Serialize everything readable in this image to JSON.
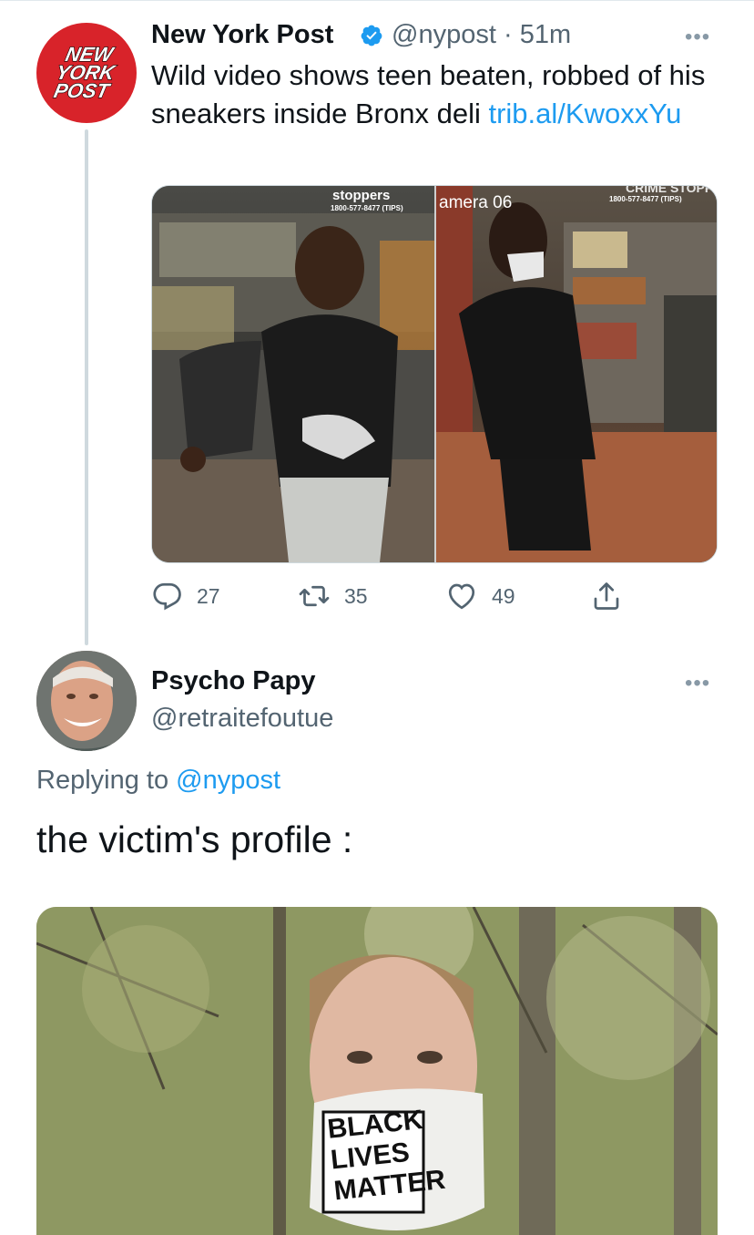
{
  "tweet": {
    "author_name": "New York Post",
    "author_handle": "@nypost",
    "separator": "·",
    "time": "51m",
    "more_label": "•••",
    "avatar_logo": [
      "NEW",
      "YORK",
      "POST"
    ],
    "text_prefix": "Wild video shows teen beaten, robbed of his sneakers inside Bronx deli ",
    "text_link": "trib.al/KwoxxYu",
    "media": {
      "left_overlay": {
        "brand": "stoppers",
        "phone": "1800-577-8477 (TIPS)"
      },
      "right_overlay": {
        "camera": "amera 06",
        "brand": "CRIME STOPPER",
        "phone": "1800-577-8477 (TIPS)"
      }
    },
    "actions": [
      {
        "name": "reply",
        "icon": "reply-icon",
        "count": "27"
      },
      {
        "name": "retweet",
        "icon": "retweet-icon",
        "count": "35"
      },
      {
        "name": "like",
        "icon": "heart-icon",
        "count": "49"
      },
      {
        "name": "share",
        "icon": "share-icon",
        "count": ""
      }
    ]
  },
  "reply": {
    "author_name": "Psycho Papy",
    "author_handle": "@retraitefoutue",
    "more_label": "•••",
    "replying_prefix": "Replying to ",
    "replying_mention": "@nypost",
    "text": "the victim's profile :",
    "mask_text": [
      "BLACK",
      "LIVES",
      "MATTER"
    ]
  },
  "colors": {
    "link": "#1d9bf0",
    "secondary_text": "#536471",
    "nyp_red": "#d8232a",
    "verified": "#1d9bf0"
  }
}
